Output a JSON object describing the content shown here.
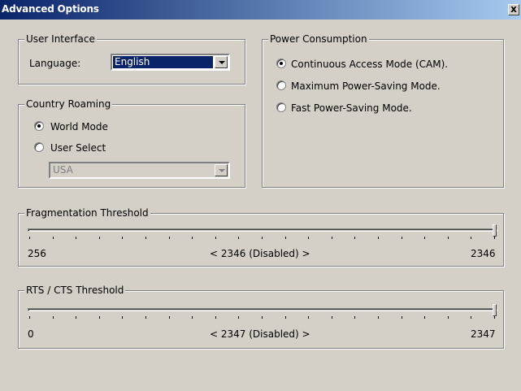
{
  "window": {
    "title": "Advanced Options",
    "close_glyph": "x"
  },
  "user_interface": {
    "legend": "User Interface",
    "language_label": "Language:",
    "language_value": "English"
  },
  "country_roaming": {
    "legend": "Country Roaming",
    "options": [
      {
        "label": "World Mode",
        "checked": true
      },
      {
        "label": "User Select",
        "checked": false
      }
    ],
    "country_value": "USA"
  },
  "power_consumption": {
    "legend": "Power Consumption",
    "options": [
      {
        "label": "Continuous Access Mode (CAM).",
        "checked": true
      },
      {
        "label": "Maximum Power-Saving Mode.",
        "checked": false
      },
      {
        "label": "Fast Power-Saving Mode.",
        "checked": false
      }
    ]
  },
  "fragmentation": {
    "legend": "Fragmentation Threshold",
    "min_label": "256",
    "max_label": "2346",
    "value_label": "< 2346 (Disabled) >",
    "min": 256,
    "max": 2346,
    "value": 2346
  },
  "rts_cts": {
    "legend": "RTS / CTS Threshold",
    "min_label": "0",
    "max_label": "2347",
    "value_label": "< 2347 (Disabled) >",
    "min": 0,
    "max": 2347,
    "value": 2347
  }
}
